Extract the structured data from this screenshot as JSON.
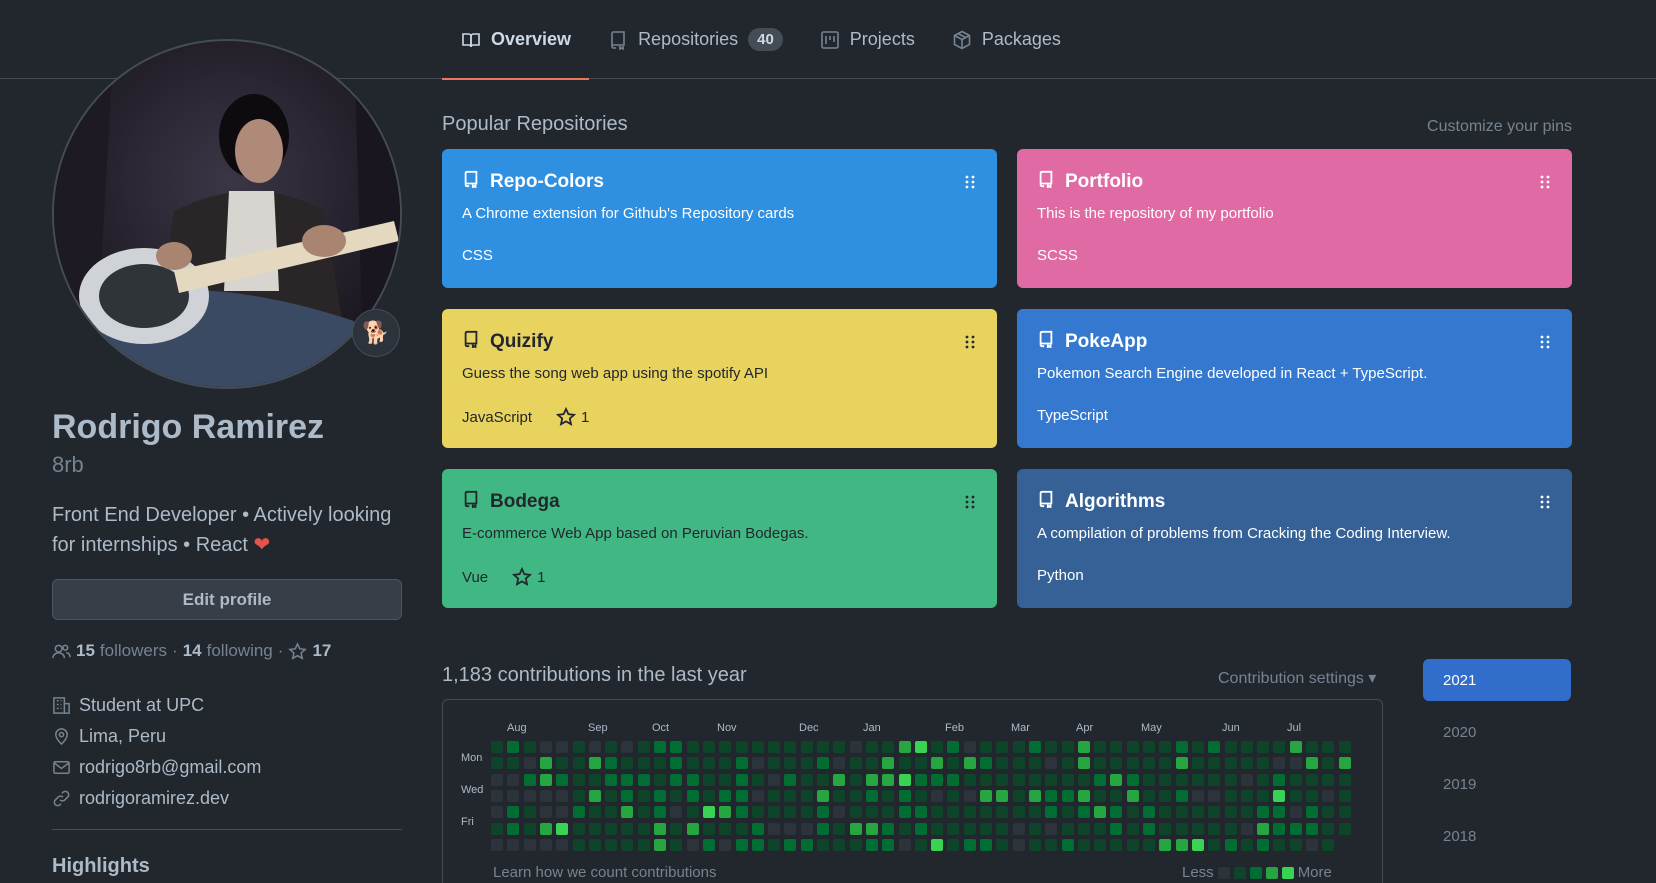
{
  "nav": {
    "tabs": [
      {
        "label": "Overview",
        "active": true
      },
      {
        "label": "Repositories",
        "count": "40"
      },
      {
        "label": "Projects"
      },
      {
        "label": "Packages"
      }
    ],
    "accent": "#ec775c"
  },
  "profile": {
    "name": "Rodrigo Ramirez",
    "login": "8rb",
    "bio": "Front End Developer • Actively looking for internships • React",
    "status_emoji": "🐕",
    "edit_label": "Edit profile",
    "followers_count": "15",
    "followers_label": "followers",
    "following_count": "14",
    "following_label": "following",
    "stars_count": "17",
    "details": [
      {
        "icon": "organization-icon",
        "text": "Student at UPC"
      },
      {
        "icon": "location-icon",
        "text": "Lima, Peru"
      },
      {
        "icon": "mail-icon",
        "text": "rodrigo8rb@gmail.com"
      },
      {
        "icon": "link-icon",
        "text": "rodrigoramirez.dev"
      }
    ],
    "highlights_title": "Highlights"
  },
  "popular": {
    "title": "Popular Repositories",
    "customize": "Customize your pins",
    "repos": [
      {
        "name": "Repo-Colors",
        "desc": "A Chrome extension for Github's Repository cards",
        "lang": "CSS",
        "stars": "",
        "color": "#2f8fe0"
      },
      {
        "name": "Portfolio",
        "desc": "This is the repository of my portfolio",
        "lang": "SCSS",
        "stars": "",
        "color": "#e06aa3"
      },
      {
        "name": "Quizify",
        "desc": "Guess the song web app using the spotify API",
        "lang": "JavaScript",
        "stars": "1",
        "color": "#e8d35e"
      },
      {
        "name": "PokeApp",
        "desc": "Pokemon Search Engine developed in React + TypeScript.",
        "lang": "TypeScript",
        "stars": "",
        "color": "#3479cf"
      },
      {
        "name": "Bodega",
        "desc": "E-commerce Web App based on Peruvian Bodegas.",
        "lang": "Vue",
        "stars": "1",
        "color": "#41b883"
      },
      {
        "name": "Algorithms",
        "desc": "A compilation of problems from Cracking the Coding Interview.",
        "lang": "Python",
        "stars": "",
        "color": "#356196"
      }
    ]
  },
  "contributions": {
    "title": "1,183 contributions in the last year",
    "settings": "Contribution settings ▾",
    "months": [
      "Aug",
      "Sep",
      "Oct",
      "Nov",
      "Dec",
      "Jan",
      "Feb",
      "Mar",
      "Apr",
      "May",
      "Jun",
      "Jul"
    ],
    "weekdays": [
      "Mon",
      "Wed",
      "Fri"
    ],
    "learn": "Learn how we count contributions",
    "legend_less": "Less",
    "legend_more": "More",
    "levels": [
      "#2d333b",
      "#0e4429",
      "#006d32",
      "#26a641",
      "#39d353"
    ],
    "years": [
      "2021",
      "2020",
      "2019",
      "2018"
    ],
    "active_year": "2021"
  }
}
